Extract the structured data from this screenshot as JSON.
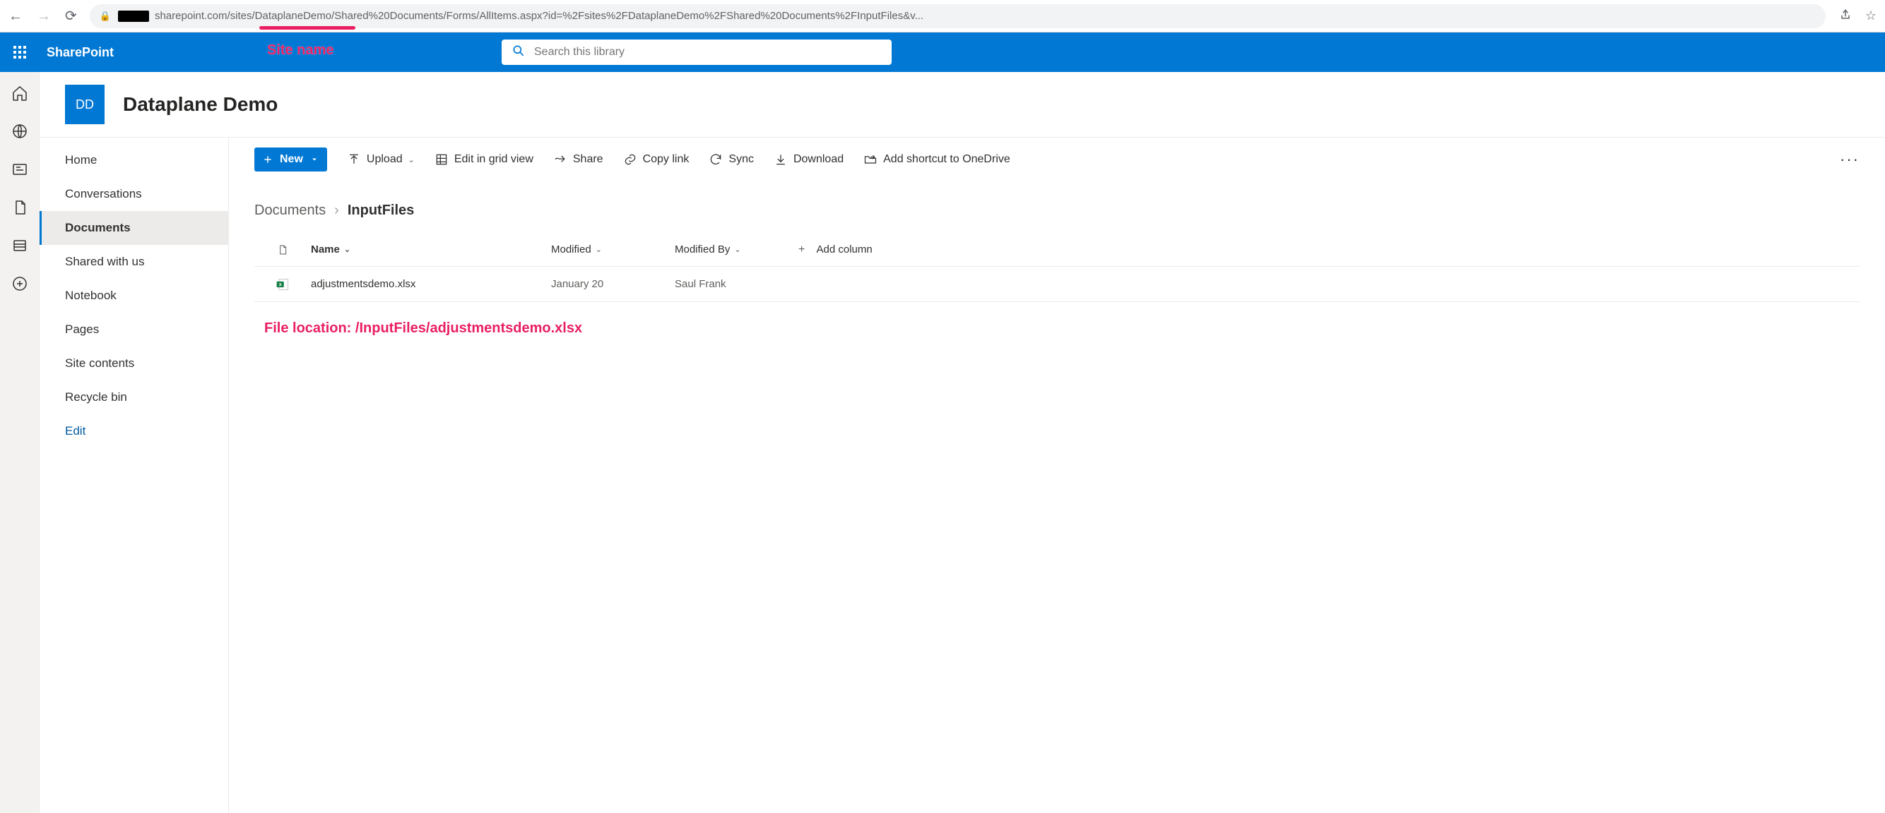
{
  "browser": {
    "url": "sharepoint.com/sites/DataplaneDemo/Shared%20Documents/Forms/AllItems.aspx?id=%2Fsites%2FDataplaneDemo%2FShared%20Documents%2FInputFiles&v..."
  },
  "annotations": {
    "site_name": "Site name",
    "file_location": "File location: /InputFiles/adjustmentsdemo.xlsx"
  },
  "suite": {
    "app_name": "SharePoint",
    "search_placeholder": "Search this library"
  },
  "site": {
    "logo_text": "DD",
    "title": "Dataplane Demo"
  },
  "site_nav": {
    "items": [
      {
        "label": "Home"
      },
      {
        "label": "Conversations"
      },
      {
        "label": "Documents"
      },
      {
        "label": "Shared with us"
      },
      {
        "label": "Notebook"
      },
      {
        "label": "Pages"
      },
      {
        "label": "Site contents"
      },
      {
        "label": "Recycle bin"
      }
    ],
    "edit_label": "Edit"
  },
  "commands": {
    "new": "New",
    "upload": "Upload",
    "edit_grid": "Edit in grid view",
    "share": "Share",
    "copy_link": "Copy link",
    "sync": "Sync",
    "download": "Download",
    "add_shortcut": "Add shortcut to OneDrive"
  },
  "breadcrumb": {
    "root": "Documents",
    "current": "InputFiles"
  },
  "grid": {
    "headers": {
      "name": "Name",
      "modified": "Modified",
      "modified_by": "Modified By",
      "add_column": "Add column"
    },
    "rows": [
      {
        "name": "adjustmentsdemo.xlsx",
        "modified": "January 20",
        "modified_by": "Saul Frank"
      }
    ]
  }
}
